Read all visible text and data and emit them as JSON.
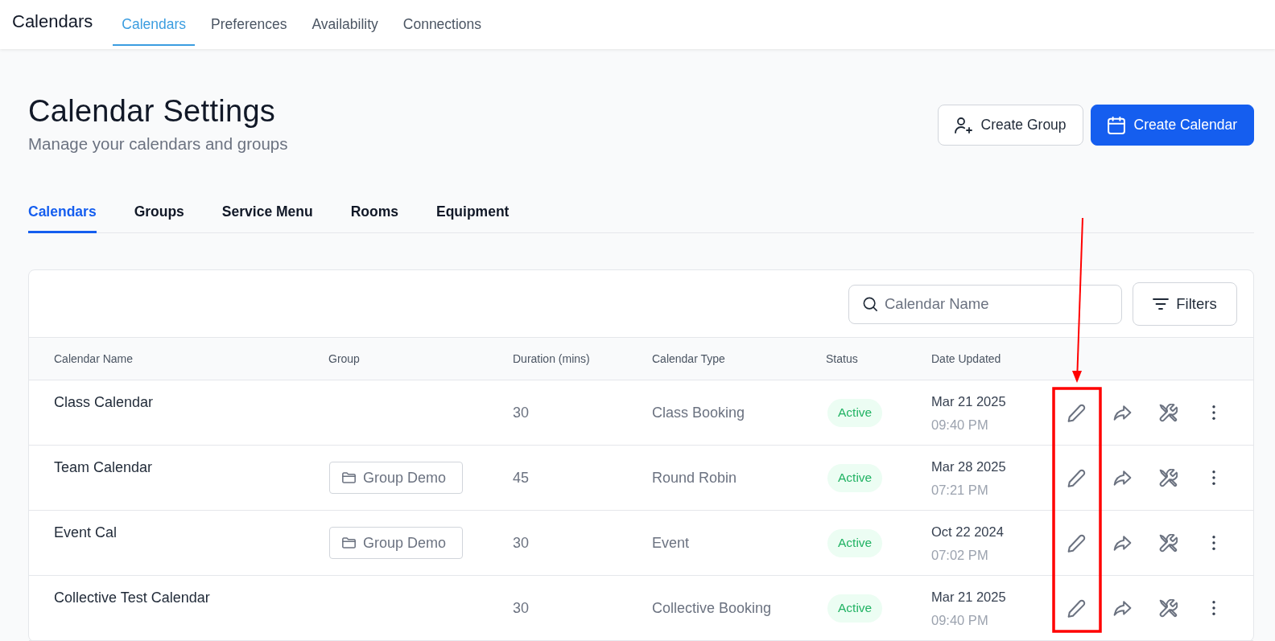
{
  "app": {
    "title": "Calendars"
  },
  "nav_tabs": [
    {
      "label": "Calendars",
      "selected": true
    },
    {
      "label": "Preferences",
      "selected": false
    },
    {
      "label": "Availability",
      "selected": false
    },
    {
      "label": "Connections",
      "selected": false
    }
  ],
  "page": {
    "title": "Calendar Settings",
    "subtitle": "Manage your calendars and groups"
  },
  "header_buttons": [
    {
      "label": "Create Group",
      "kind": "secondary"
    },
    {
      "label": "Create Calendar",
      "kind": "primary"
    }
  ],
  "sub_tabs": [
    {
      "label": "Calendars",
      "selected": true
    },
    {
      "label": "Groups",
      "selected": false
    },
    {
      "label": "Service Menu",
      "selected": false
    },
    {
      "label": "Rooms",
      "selected": false
    },
    {
      "label": "Equipment",
      "selected": false
    }
  ],
  "search": {
    "placeholder": "Calendar Name"
  },
  "filters_button": {
    "label": "Filters"
  },
  "table": {
    "columns": [
      "Calendar Name",
      "Group",
      "Duration (mins)",
      "Calendar Type",
      "Status",
      "Date Updated"
    ],
    "rows": [
      {
        "name": "Class Calendar",
        "duration": "30",
        "calendar_type": "Class Booking",
        "status": "Active",
        "date": "Mar 21 2025",
        "time": "09:40 PM"
      },
      {
        "name": "Team Calendar",
        "group": "Group Demo",
        "duration": "45",
        "calendar_type": "Round Robin",
        "status": "Active",
        "date": "Mar 28 2025",
        "time": "07:21 PM"
      },
      {
        "name": "Event Cal",
        "group": "Group Demo",
        "duration": "30",
        "calendar_type": "Event",
        "status": "Active",
        "date": "Oct 22 2024",
        "time": "07:02 PM"
      },
      {
        "name": "Collective Test Calendar",
        "duration": "30",
        "calendar_type": "Collective Booking",
        "status": "Active",
        "date": "Mar 21 2025",
        "time": "09:40 PM"
      }
    ]
  },
  "annotation": {
    "kind": "arrow-box"
  }
}
